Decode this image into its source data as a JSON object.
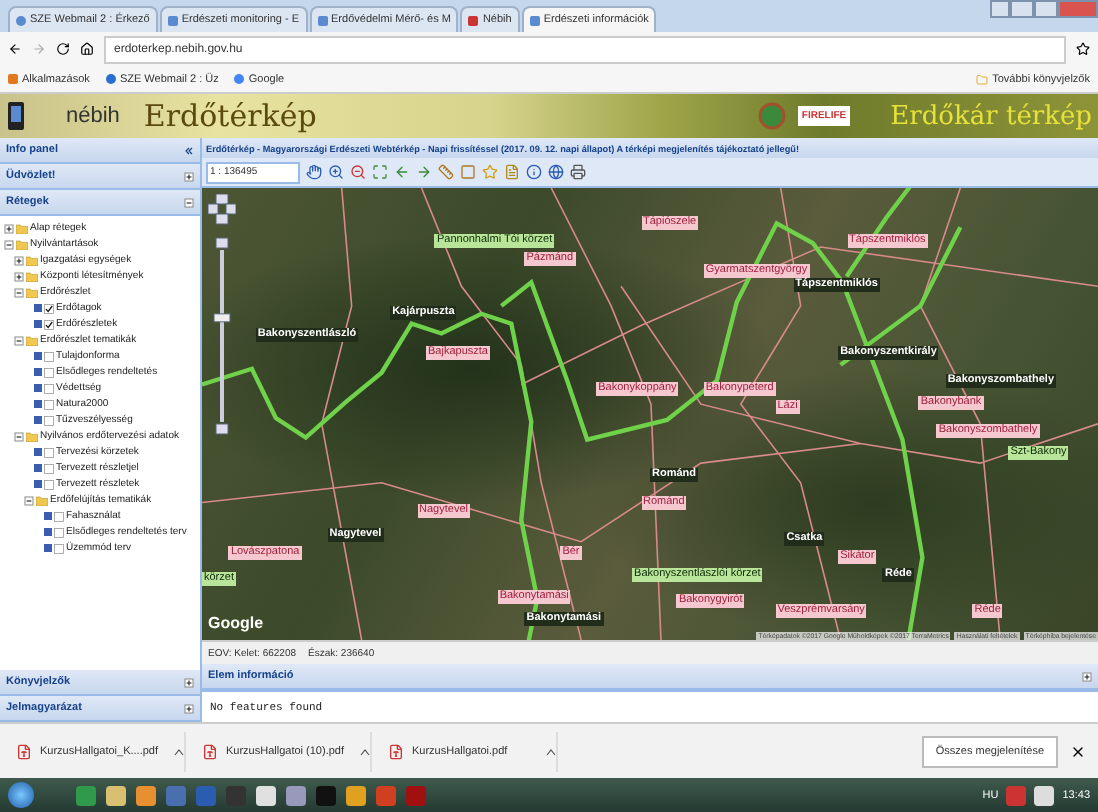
{
  "browser": {
    "tabs": [
      {
        "label": "SZE Webmail 2 : Érkező",
        "selected": false
      },
      {
        "label": "Erdészeti monitoring - E",
        "selected": false
      },
      {
        "label": "Erdővédelmi Mérő- és M",
        "selected": false
      },
      {
        "label": "Nébih",
        "selected": false
      },
      {
        "label": "Erdészeti információk",
        "selected": true
      }
    ],
    "address": "erdoterkep.nebih.gov.hu",
    "bookmarks": [
      "Alkalmazások",
      "SZE Webmail 2 : Üz",
      "Google"
    ],
    "other_bookmarks": "További könyvjelzők"
  },
  "banner": {
    "logo": "nébih",
    "title": "Erdőtérkép",
    "partner": "FIRELIFE",
    "link_title": "Erdőkár térkép"
  },
  "sidebar": {
    "title": "Info panel",
    "top_panels": [
      {
        "title": "Üdvözlet!",
        "expanded": false
      },
      {
        "title": "Rétegek",
        "expanded": true
      }
    ],
    "bottom_panels": [
      {
        "title": "Könyvjelzők",
        "expanded": false
      },
      {
        "title": "Jelmagyarázat",
        "expanded": false
      }
    ]
  },
  "layers": [
    {
      "kind": "folder",
      "label": "Alap rétegek",
      "expanded": false
    },
    {
      "kind": "folder",
      "label": "Nyilvántartások",
      "expanded": true,
      "children": [
        {
          "kind": "folder",
          "label": "Igazgatási egységek",
          "expanded": false
        },
        {
          "kind": "folder",
          "label": "Központi létesítmények",
          "expanded": false
        },
        {
          "kind": "folder",
          "label": "Erdőrészlet",
          "expanded": true,
          "children": [
            {
              "kind": "layer",
              "label": "Erdőtagok",
              "checked": true
            },
            {
              "kind": "layer",
              "label": "Erdőrészletek",
              "checked": true
            }
          ]
        },
        {
          "kind": "folder",
          "label": "Erdőrészlet tematikák",
          "expanded": true,
          "children": [
            {
              "kind": "layer",
              "label": "Tulajdonforma",
              "checked": false
            },
            {
              "kind": "layer",
              "label": "Elsődleges rendeltetés",
              "checked": false
            },
            {
              "kind": "layer",
              "label": "Védettség",
              "checked": false
            },
            {
              "kind": "layer",
              "label": "Natura2000",
              "checked": false
            },
            {
              "kind": "layer",
              "label": "Tűzveszélyesség",
              "checked": false
            }
          ]
        },
        {
          "kind": "folder",
          "label": "Nyilvános erdőtervezési adatok",
          "expanded": true,
          "children": [
            {
              "kind": "layer",
              "label": "Tervezési körzetek",
              "checked": false
            },
            {
              "kind": "layer",
              "label": "Tervezett részletjel",
              "checked": false
            },
            {
              "kind": "layer",
              "label": "Tervezett részletek",
              "checked": false
            },
            {
              "kind": "folder",
              "label": "Erdőfelújítás tematikák",
              "expanded": true,
              "children": [
                {
                  "kind": "layer",
                  "label": "Fahasználat",
                  "checked": false
                },
                {
                  "kind": "layer",
                  "label": "Elsődleges rendeltetés terv",
                  "checked": false
                },
                {
                  "kind": "layer",
                  "label": "Üzemmód terv",
                  "checked": false
                }
              ]
            }
          ]
        }
      ]
    }
  ],
  "map": {
    "title": "Erdőtérkép - Magyarországi Erdészeti Webtérkép - Napi frissítéssel (2017. 09. 12. napi állapot) A térképi megjelenítés tájékoztató jellegű!",
    "scale": "1 : 136495",
    "labels": [
      {
        "text": "Pannonhalmi Tói körzet",
        "kind": "district"
      },
      {
        "text": "Tápiószele",
        "kind": "town"
      },
      {
        "text": "Tápszentmiklós",
        "kind": "town"
      },
      {
        "text": "Pázmánd",
        "kind": "town"
      },
      {
        "text": "Gyarmatszentgyörgy",
        "kind": "town"
      },
      {
        "text": "Tápszentmiklós",
        "kind": "village"
      },
      {
        "text": "Kajárpuszta",
        "kind": "village"
      },
      {
        "text": "Bakonyszentlászló",
        "kind": "village"
      },
      {
        "text": "Bajkapuszta",
        "kind": "town"
      },
      {
        "text": "Bakonykoppány",
        "kind": "town"
      },
      {
        "text": "Bakonyszentkirály",
        "kind": "village"
      },
      {
        "text": "Bakonypéterd",
        "kind": "town"
      },
      {
        "text": "Lázi",
        "kind": "town"
      },
      {
        "text": "Bakonyszombathely",
        "kind": "village"
      },
      {
        "text": "Bakonybánk",
        "kind": "town"
      },
      {
        "text": "Bakonyszombathely",
        "kind": "town"
      },
      {
        "text": "Szt-Bakony",
        "kind": "district"
      },
      {
        "text": "Románd",
        "kind": "village"
      },
      {
        "text": "Románd",
        "kind": "town"
      },
      {
        "text": "Nagytevel",
        "kind": "town"
      },
      {
        "text": "Nagytevel",
        "kind": "village"
      },
      {
        "text": "Lovászpatona",
        "kind": "town"
      },
      {
        "text": "körzet",
        "kind": "district"
      },
      {
        "text": "Csatka",
        "kind": "village"
      },
      {
        "text": "Sikátor",
        "kind": "town"
      },
      {
        "text": "Bér",
        "kind": "town"
      },
      {
        "text": "Bakonyszentlászlói körzet",
        "kind": "district"
      },
      {
        "text": "Réde",
        "kind": "village"
      },
      {
        "text": "Bakonygyirót",
        "kind": "town"
      },
      {
        "text": "Veszprémvarsány",
        "kind": "town"
      },
      {
        "text": "Réde",
        "kind": "town"
      },
      {
        "text": "Bakonytamási",
        "kind": "town"
      },
      {
        "text": "Bakonytamási",
        "kind": "village"
      }
    ],
    "zoom": {
      "level": 0.62
    },
    "google": "Google",
    "attribution": [
      "Térképadatok ©2017 Google Műholdképek ©2017 TerraMetrics",
      "Használati feltételek",
      "Térképhiba bejelentése"
    ],
    "status": [
      "EOV: Kelet: 662208",
      "Észak: 236640"
    ]
  },
  "info": {
    "title": "Elem információ",
    "message": "No features found"
  },
  "downloads": {
    "files": [
      "KurzusHallgatoi_K....pdf",
      "KurzusHallgatoi (10).pdf",
      "KurzusHallgatoi.pdf"
    ],
    "show_all": "Összes megjelenítése"
  },
  "taskbar": {
    "language": "HU",
    "time": "13:43"
  }
}
